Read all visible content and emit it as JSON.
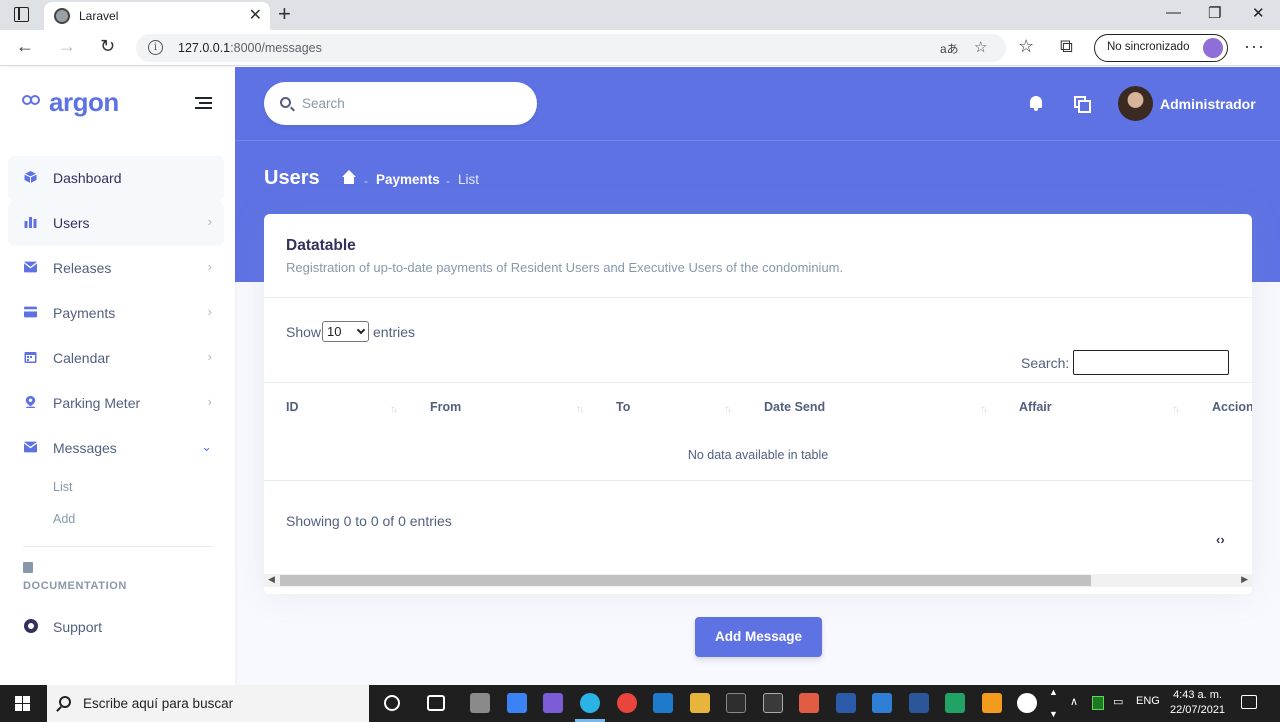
{
  "browser": {
    "tab_title": "Laravel",
    "url_host": "127.0.0.1",
    "url_path": ":8000/messages",
    "sync_label": "No sincronizado"
  },
  "sidebar": {
    "brand": "argon",
    "items": [
      {
        "label": "Dashboard",
        "icon": "cube-icon",
        "color": "#5e72e4"
      },
      {
        "label": "Users",
        "icon": "bar-chart-icon",
        "color": "#5e72e4"
      },
      {
        "label": "Releases",
        "icon": "envelope-icon",
        "color": "#5e72e4"
      },
      {
        "label": "Payments",
        "icon": "credit-card-icon",
        "color": "#5e72e4"
      },
      {
        "label": "Calendar",
        "icon": "calendar-icon",
        "color": "#5e72e4"
      },
      {
        "label": "Parking Meter",
        "icon": "map-pin-icon",
        "color": "#5e72e4"
      },
      {
        "label": "Messages",
        "icon": "envelope-icon",
        "color": "#5e72e4"
      }
    ],
    "sub_items": [
      "List",
      "Add"
    ],
    "doc_heading": "DOCUMENTATION",
    "support_label": "Support"
  },
  "header": {
    "search_placeholder": "Search",
    "user_name": "Administrador",
    "page_title": "Users",
    "breadcrumb": [
      "Payments",
      "List"
    ]
  },
  "card": {
    "title": "Datatable",
    "subtitle": "Registration of up-to-date payments of Resident Users and Executive Users of the condominium.",
    "show_label": "Show",
    "page_length": "10",
    "entries_label": "entries",
    "search_label": "Search:",
    "columns": [
      "ID",
      "From",
      "To",
      "Date Send",
      "Affair",
      "Accion"
    ],
    "empty_text": "No data available in table",
    "info_text": "Showing 0 to 0 of 0 entries",
    "pager_glyph": "‹›"
  },
  "actions": {
    "add_label": "Add Message"
  },
  "taskbar": {
    "search_text": "Escribe aquí para buscar",
    "lang": "ENG",
    "time": "4:43 a. m.",
    "date": "22/07/2021"
  },
  "colors": {
    "primary": "#5e72e4",
    "background": "#f8f9fe"
  }
}
